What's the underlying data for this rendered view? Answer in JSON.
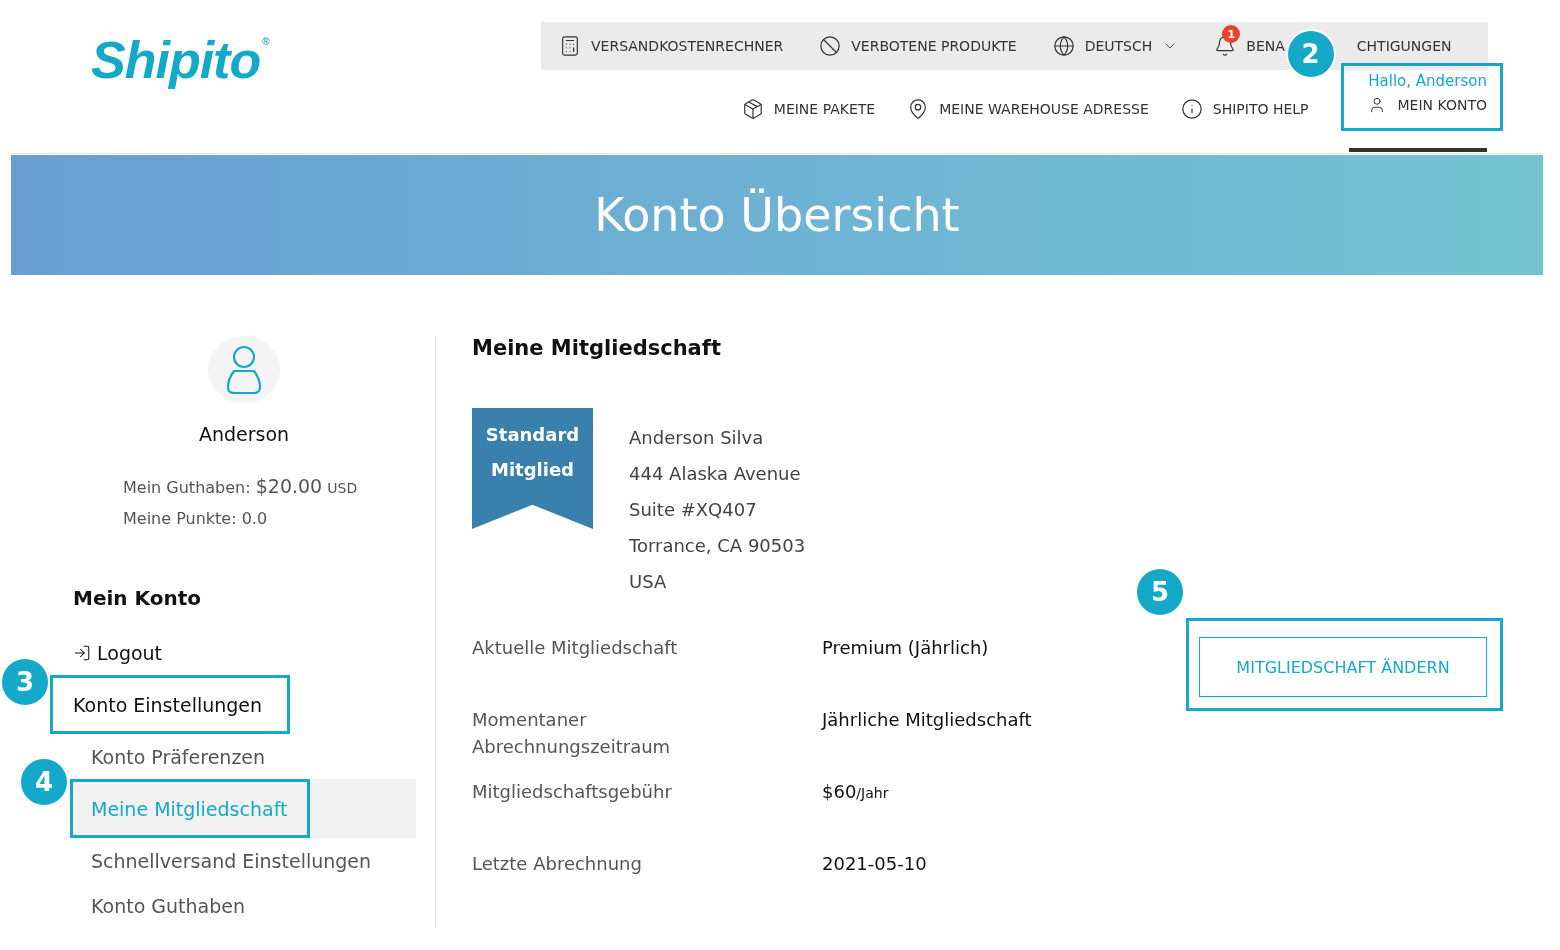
{
  "logo": {
    "text": "Shipito",
    "mark": "®"
  },
  "top_bar": {
    "items": [
      {
        "kind": "link",
        "label": "VERSANDKOSTENRECHNER"
      },
      {
        "kind": "link",
        "label": "VERBOTENE PRODUKTE"
      },
      {
        "kind": "dropdown",
        "label": "DEUTSCH"
      },
      {
        "kind": "notifications",
        "label_parts": [
          "BENA",
          "CHTIGUNGEN"
        ],
        "badge": "1"
      }
    ]
  },
  "main_nav": {
    "items": [
      {
        "label": "MEINE PAKETE"
      },
      {
        "label": "MEINE WAREHOUSE ADRESSE"
      },
      {
        "label": "SHIPITO HELP"
      }
    ],
    "account": {
      "greeting": "Hallo, Anderson",
      "label": "MEIN KONTO",
      "active": true,
      "callout": "2"
    }
  },
  "banner": {
    "title": "Konto Übersicht"
  },
  "sidebar": {
    "name": "Anderson",
    "balance": {
      "label": "Mein Guthaben:",
      "amount": "$20.00",
      "currency": "USD"
    },
    "points": "Meine Punkte: 0.0",
    "heading": "Mein Konto",
    "items": [
      {
        "kind": "logout",
        "label": "Logout",
        "selected": false
      },
      {
        "kind": "section",
        "label": "Konto Einstellungen",
        "selected": false,
        "callout": "3"
      },
      {
        "kind": "sub",
        "label": "Konto Präferenzen",
        "selected": false
      },
      {
        "kind": "sub",
        "label": "Meine Mitgliedschaft",
        "selected": true,
        "callout": "4"
      },
      {
        "kind": "sub",
        "label": "Schnellversand Einstellungen",
        "selected": false
      },
      {
        "kind": "sub",
        "label": "Konto Guthaben",
        "selected": false
      }
    ]
  },
  "membership": {
    "heading": "Meine Mitgliedschaft",
    "ribbon": [
      "Standard",
      "Mitglied"
    ],
    "address": [
      "Anderson Silva",
      "444 Alaska Avenue",
      "Suite #XQ407",
      "Torrance, CA 90503",
      "USA"
    ],
    "rows": [
      {
        "label": "Aktuelle Mitgliedschaft",
        "value": "Premium (Jährlich)"
      },
      {
        "label": "Momentaner Abrechnungszeitraum",
        "value": "Jährliche Mitgliedschaft"
      },
      {
        "label": "Mitgliedschaftsgebühr",
        "value": "$60",
        "unit": "/Jahr"
      },
      {
        "label": "Letzte Abrechnung",
        "value": "2021-05-10"
      }
    ],
    "button": {
      "label": "MITGLIEDSCHAFT ÄNDERN",
      "callout": "5"
    }
  }
}
